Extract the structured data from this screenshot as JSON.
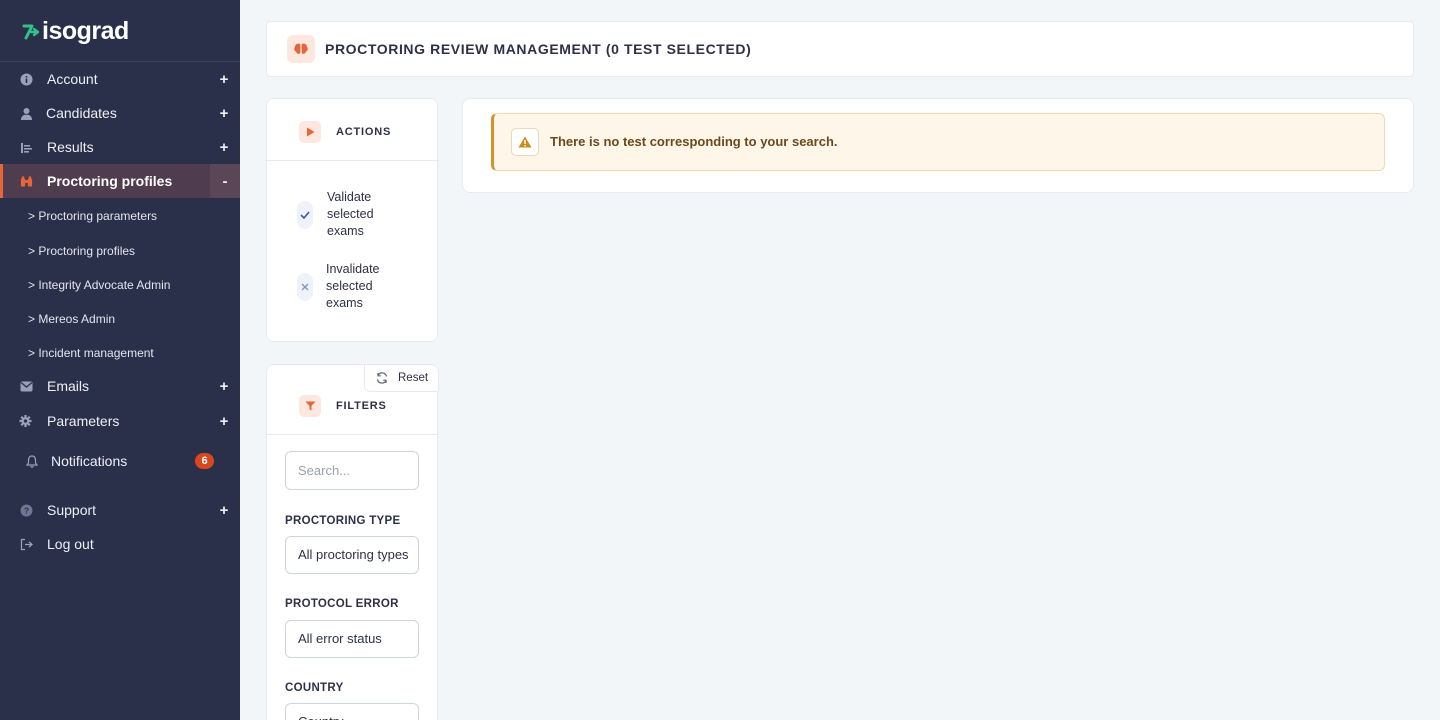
{
  "brand": {
    "name": "isograd",
    "accent": "#e8643a",
    "logo_mark_color": "#2fc28a"
  },
  "sidebar": {
    "items": [
      {
        "label": "Account",
        "icon": "info-icon",
        "toggle": "+"
      },
      {
        "label": "Candidates",
        "icon": "user-icon",
        "toggle": "+"
      },
      {
        "label": "Results",
        "icon": "list-icon",
        "toggle": "+"
      },
      {
        "label": "Proctoring profiles",
        "icon": "binoculars-icon",
        "toggle": "-",
        "active": true
      }
    ],
    "subitems": [
      "> Proctoring parameters",
      "> Proctoring profiles",
      "> Integrity Advocate Admin",
      "> Mereos Admin",
      "> Incident management"
    ],
    "items_after": [
      {
        "label": "Emails",
        "icon": "envelope-icon",
        "toggle": "+"
      },
      {
        "label": "Parameters",
        "icon": "gear-icon",
        "toggle": "+"
      }
    ],
    "notifications": {
      "label": "Notifications",
      "count": "6"
    },
    "support": {
      "label": "Support",
      "toggle": "+"
    },
    "logout": {
      "label": "Log out"
    }
  },
  "header": {
    "title": "PROCTORING REVIEW MANAGEMENT (0 TEST SELECTED)"
  },
  "actions": {
    "title": "ACTIONS",
    "validate_label": "Validate selected exams",
    "invalidate_label": "Invalidate selected exams"
  },
  "filters": {
    "title": "FILTERS",
    "reset_label": "Reset",
    "search_placeholder": "Search...",
    "proctoring_type_label": "PROCTORING TYPE",
    "proctoring_type_value": "All proctoring types",
    "protocol_error_label": "PROTOCOL ERROR",
    "protocol_error_value": "All error status",
    "country_label": "COUNTRY",
    "country_value": "Country"
  },
  "results": {
    "alert_text": "There is no test corresponding to your search."
  }
}
